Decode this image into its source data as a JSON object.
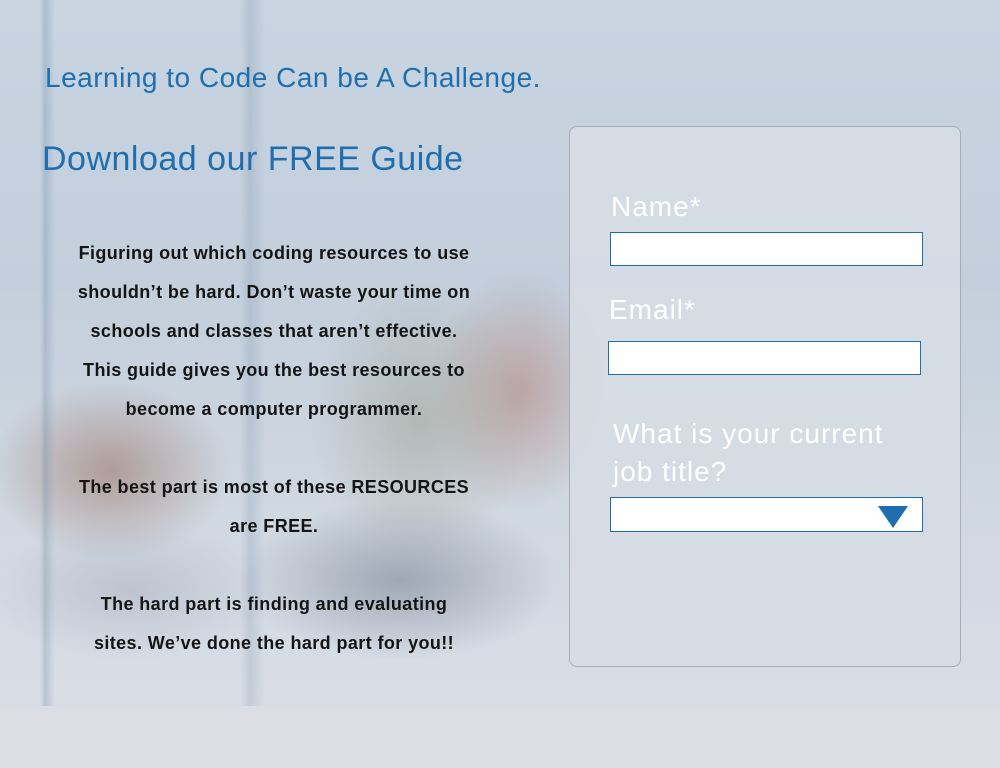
{
  "hero": {
    "headline": "Learning to Code Can be A Challenge.",
    "subhead": "Download our FREE Guide",
    "copy_paragraphs": [
      [
        "Figuring out which coding resources to use",
        "shouldn’t be hard. Don’t waste your time on",
        "schools and classes that aren’t effective.",
        "This guide gives you the best resources to",
        "become a computer programmer."
      ],
      [
        "The best part is most of these RESOURCES",
        "are FREE."
      ],
      [
        "The hard part is finding and evaluating",
        "sites. We’ve done the hard part for you!!"
      ]
    ]
  },
  "form": {
    "name_label": "Name*",
    "name_value": "",
    "email_label": "Email*",
    "email_value": "",
    "job_title_label_line1": "What is your current",
    "job_title_label_line2": "job title?",
    "job_title_selected": "",
    "select_icon": "triangle-down-icon"
  },
  "colors": {
    "accent": "#1f6fae",
    "label": "#ffffff",
    "body_text": "#141414"
  }
}
